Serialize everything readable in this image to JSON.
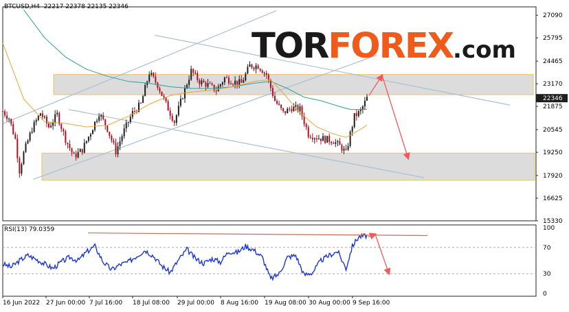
{
  "header": {
    "symbol": "BTCUSD,H4",
    "ohlc": "22217 22378 22135 22346"
  },
  "logo": {
    "part1": "TOR",
    "part2": "FOREX",
    "part3": ".com",
    "icon": "bull-bear-icon"
  },
  "colors": {
    "bull_candle": "#1e1e1e",
    "bear_candle": "#b1101e",
    "ma_fast": "#e8a533",
    "ma_slow": "#2aa198",
    "channel": "#a9bfd6",
    "zone_border": "#e9c36a",
    "zone_fill": "#d9d9d9",
    "arrow": "#f05a5a",
    "rsi_line": "#1a35d6",
    "rsi_trend": "#c86c5a",
    "price_tag_bg": "#1e1e1e",
    "price_tag_fg": "#ffffff"
  },
  "chart_data": [
    {
      "type": "line",
      "title": "BTCUSD,H4",
      "ylim": [
        15330,
        27570
      ],
      "y_ticks": [
        15330,
        16625,
        17920,
        19250,
        20545,
        21875,
        23170,
        24465,
        25795,
        27090
      ],
      "current_price": 22346,
      "x_ticks": [
        "16 Jun 2022",
        "27 Jun 00:00",
        "7 Jul 16:00",
        "18 Jul 08:00",
        "29 Jul 00:00",
        "8 Aug 16:00",
        "19 Aug 08:00",
        "30 Aug 00:00",
        "9 Sep 16:00"
      ],
      "price_path": [
        [
          0,
          21600
        ],
        [
          3,
          21200
        ],
        [
          6,
          20000
        ],
        [
          8,
          18200
        ],
        [
          10,
          19200
        ],
        [
          14,
          20600
        ],
        [
          18,
          21500
        ],
        [
          22,
          20700
        ],
        [
          26,
          21400
        ],
        [
          30,
          20000
        ],
        [
          34,
          19000
        ],
        [
          38,
          19400
        ],
        [
          42,
          20400
        ],
        [
          46,
          21500
        ],
        [
          50,
          20600
        ],
        [
          54,
          19300
        ],
        [
          58,
          20500
        ],
        [
          62,
          21500
        ],
        [
          66,
          22000
        ],
        [
          70,
          23800
        ],
        [
          74,
          23100
        ],
        [
          78,
          22000
        ],
        [
          82,
          21000
        ],
        [
          86,
          22500
        ],
        [
          90,
          23900
        ],
        [
          94,
          23300
        ],
        [
          98,
          23100
        ],
        [
          102,
          22800
        ],
        [
          106,
          23500
        ],
        [
          110,
          23300
        ],
        [
          114,
          23200
        ],
        [
          118,
          24200
        ],
        [
          122,
          24200
        ],
        [
          126,
          23700
        ],
        [
          130,
          22200
        ],
        [
          134,
          21500
        ],
        [
          138,
          21800
        ],
        [
          142,
          21700
        ],
        [
          146,
          20300
        ],
        [
          150,
          20100
        ],
        [
          154,
          20000
        ],
        [
          158,
          19900
        ],
        [
          162,
          19500
        ],
        [
          164,
          19200
        ],
        [
          166,
          20300
        ],
        [
          168,
          21300
        ],
        [
          171,
          21600
        ],
        [
          174,
          22346
        ]
      ],
      "ma_fast": [
        [
          0,
          25500
        ],
        [
          10,
          22300
        ],
        [
          20,
          21000
        ],
        [
          30,
          20900
        ],
        [
          40,
          20700
        ],
        [
          50,
          20800
        ],
        [
          60,
          21300
        ],
        [
          70,
          22000
        ],
        [
          80,
          22500
        ],
        [
          90,
          22700
        ],
        [
          100,
          22800
        ],
        [
          110,
          23000
        ],
        [
          120,
          23300
        ],
        [
          128,
          23400
        ],
        [
          135,
          22500
        ],
        [
          142,
          21500
        ],
        [
          150,
          20700
        ],
        [
          158,
          20300
        ],
        [
          164,
          20100
        ],
        [
          170,
          20500
        ],
        [
          174,
          20800
        ]
      ],
      "ma_slow": [
        [
          10,
          27400
        ],
        [
          20,
          25800
        ],
        [
          30,
          24700
        ],
        [
          40,
          24000
        ],
        [
          50,
          23600
        ],
        [
          60,
          23300
        ],
        [
          70,
          23200
        ],
        [
          80,
          23000
        ],
        [
          90,
          22900
        ],
        [
          100,
          22900
        ],
        [
          110,
          23000
        ],
        [
          120,
          23200
        ],
        [
          128,
          23300
        ],
        [
          136,
          22900
        ],
        [
          144,
          22400
        ],
        [
          152,
          22200
        ],
        [
          160,
          21900
        ],
        [
          166,
          21700
        ],
        [
          174,
          21700
        ]
      ],
      "rsi": {
        "label": "RSI(13) 79.0359",
        "ylim": [
          0,
          100
        ],
        "levels": [
          70,
          30
        ],
        "ticks": [
          100,
          70,
          30,
          0
        ],
        "values": [
          [
            0,
            45
          ],
          [
            4,
            40
          ],
          [
            8,
            50
          ],
          [
            12,
            58
          ],
          [
            16,
            52
          ],
          [
            20,
            45
          ],
          [
            24,
            38
          ],
          [
            28,
            48
          ],
          [
            32,
            55
          ],
          [
            36,
            50
          ],
          [
            40,
            63
          ],
          [
            44,
            72
          ],
          [
            48,
            48
          ],
          [
            52,
            36
          ],
          [
            56,
            44
          ],
          [
            60,
            48
          ],
          [
            64,
            57
          ],
          [
            68,
            66
          ],
          [
            72,
            57
          ],
          [
            76,
            42
          ],
          [
            80,
            32
          ],
          [
            84,
            51
          ],
          [
            88,
            67
          ],
          [
            92,
            53
          ],
          [
            96,
            46
          ],
          [
            100,
            53
          ],
          [
            104,
            48
          ],
          [
            108,
            64
          ],
          [
            112,
            62
          ],
          [
            116,
            72
          ],
          [
            120,
            66
          ],
          [
            124,
            55
          ],
          [
            128,
            22
          ],
          [
            132,
            30
          ],
          [
            136,
            55
          ],
          [
            140,
            58
          ],
          [
            144,
            28
          ],
          [
            148,
            32
          ],
          [
            152,
            50
          ],
          [
            156,
            58
          ],
          [
            160,
            64
          ],
          [
            164,
            38
          ],
          [
            167,
            72
          ],
          [
            170,
            86
          ],
          [
            174,
            88
          ]
        ]
      }
    }
  ]
}
